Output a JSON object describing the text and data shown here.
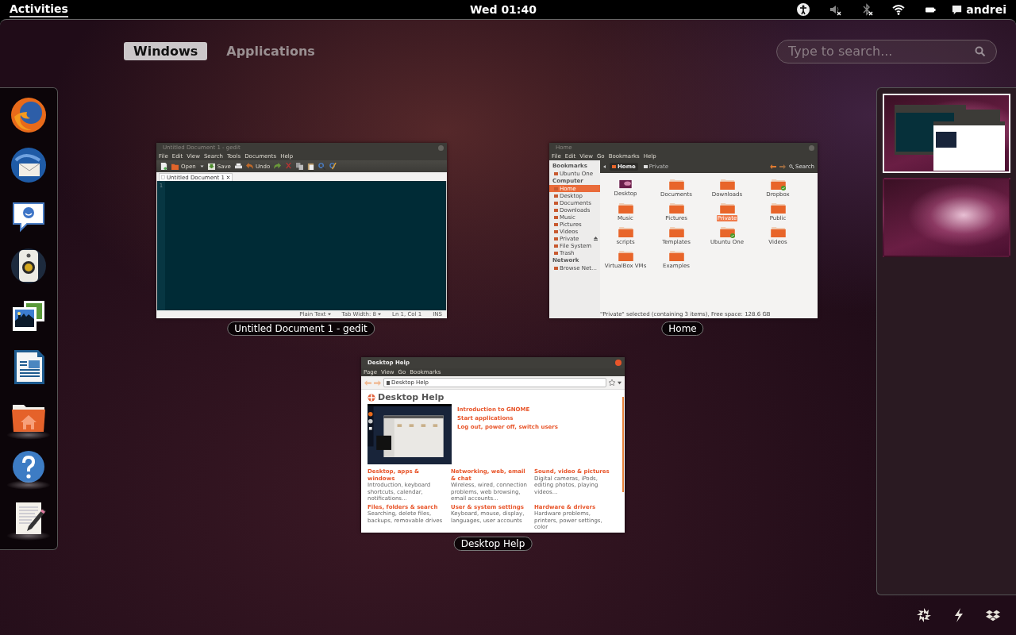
{
  "top_bar": {
    "activities": "Activities",
    "clock": "Wed 01:40",
    "user": "andrei"
  },
  "view_tabs": [
    {
      "label": "Windows",
      "selected": true
    },
    {
      "label": "Applications",
      "selected": false
    }
  ],
  "search": {
    "placeholder": "Type to search..."
  },
  "dash": [
    {
      "kind": "browser",
      "running": false
    },
    {
      "kind": "mail",
      "running": false
    },
    {
      "kind": "chat",
      "running": false
    },
    {
      "kind": "music",
      "running": false
    },
    {
      "kind": "photos",
      "running": false
    },
    {
      "kind": "writer",
      "running": false
    },
    {
      "kind": "files",
      "running": true
    },
    {
      "kind": "help",
      "running": true
    },
    {
      "kind": "editor",
      "running": true
    }
  ],
  "editor_window": {
    "title": "Untitled Document 1 - gedit",
    "caption": "Untitled Document 1 - gedit",
    "menu": [
      "File",
      "Edit",
      "View",
      "Search",
      "Tools",
      "Documents",
      "Help"
    ],
    "toolbar": [
      {
        "kind": "new"
      },
      {
        "kind": "open",
        "label": "Open"
      },
      {
        "kind": "dropdown"
      },
      {
        "kind": "save",
        "label": "Save"
      },
      {
        "kind": "print"
      },
      {
        "kind": "undo",
        "label": "Undo"
      },
      {
        "kind": "redo"
      },
      {
        "kind": "cut"
      },
      {
        "kind": "copy"
      },
      {
        "kind": "paste"
      },
      {
        "kind": "find"
      },
      {
        "kind": "replace"
      }
    ],
    "tab": "Untitled Document 1",
    "line_number": "1",
    "status": [
      {
        "text": "Plain Text",
        "dropdown": true
      },
      {
        "text": "Tab Width: 8",
        "dropdown": true
      },
      {
        "text": "Ln 1, Col 1",
        "dropdown": false
      },
      {
        "text": "INS",
        "dropdown": false
      }
    ]
  },
  "files_window": {
    "title": "Home",
    "caption": "Home",
    "menu": [
      "File",
      "Edit",
      "View",
      "Go",
      "Bookmarks",
      "Help"
    ],
    "sidebar": [
      {
        "heading": "Bookmarks",
        "items": [
          {
            "label": "Ubuntu One",
            "selected": false,
            "ejectable": false
          }
        ]
      },
      {
        "heading": "Computer",
        "items": [
          {
            "label": "Home",
            "selected": true,
            "ejectable": false
          },
          {
            "label": "Desktop",
            "selected": false,
            "ejectable": false
          },
          {
            "label": "Documents",
            "selected": false,
            "ejectable": false
          },
          {
            "label": "Downloads",
            "selected": false,
            "ejectable": false
          },
          {
            "label": "Music",
            "selected": false,
            "ejectable": false
          },
          {
            "label": "Pictures",
            "selected": false,
            "ejectable": false
          },
          {
            "label": "Videos",
            "selected": false,
            "ejectable": false
          },
          {
            "label": "Private",
            "selected": false,
            "ejectable": true
          },
          {
            "label": "File System",
            "selected": false,
            "ejectable": false
          },
          {
            "label": "Trash",
            "selected": false,
            "ejectable": false
          }
        ]
      },
      {
        "heading": "Network",
        "items": [
          {
            "label": "Browse Net…",
            "selected": false,
            "ejectable": false
          }
        ]
      }
    ],
    "path": [
      {
        "label": "Home",
        "selected": true
      },
      {
        "label": "Private",
        "selected": false
      }
    ],
    "search_label": "Search",
    "items": [
      {
        "name": "Desktop",
        "selected": false,
        "synced": false
      },
      {
        "name": "Documents",
        "kind": "folder",
        "selected": false,
        "synced": false
      },
      {
        "name": "Downloads",
        "kind": "folder",
        "selected": false,
        "synced": false
      },
      {
        "name": "Dropbox",
        "kind": "folder",
        "selected": false,
        "synced": true
      },
      {
        "name": "Music",
        "kind": "folder",
        "selected": false,
        "synced": false
      },
      {
        "name": "Pictures",
        "kind": "folder",
        "selected": false,
        "synced": false
      },
      {
        "name": "Private",
        "kind": "folder",
        "selected": true,
        "synced": false
      },
      {
        "name": "Public",
        "kind": "folder",
        "selected": false,
        "synced": false
      },
      {
        "name": "scripts",
        "kind": "folder",
        "selected": false,
        "synced": false
      },
      {
        "name": "Templates",
        "kind": "folder",
        "selected": false,
        "synced": false
      },
      {
        "name": "Ubuntu One",
        "kind": "folder",
        "selected": false,
        "synced": true
      },
      {
        "name": "Videos",
        "kind": "folder",
        "selected": false,
        "synced": false
      },
      {
        "name": "VirtualBox VMs",
        "kind": "folder",
        "selected": false,
        "synced": false
      },
      {
        "name": "Examples",
        "kind": "folder",
        "selected": false,
        "synced": false
      }
    ],
    "status": "\"Private\" selected (containing 3 items), Free space: 128.6 GB"
  },
  "help_window": {
    "title": "Desktop Help",
    "caption": "Desktop Help",
    "menu": [
      "Page",
      "View",
      "Go",
      "Bookmarks"
    ],
    "address": "Desktop Help",
    "heading": "Desktop Help",
    "links": [
      "Introduction to GNOME",
      "Start applications",
      "Log out, power off, switch users"
    ],
    "topics": [
      {
        "title": "Desktop, apps & windows",
        "text": "Introduction, keyboard shortcuts, calendar, notifications..."
      },
      {
        "title": "Networking, web, email & chat",
        "text": "Wireless, wired, connection problems, web browsing, email accounts..."
      },
      {
        "title": "Sound, video & pictures",
        "text": "Digital cameras, iPods, editing photos, playing videos..."
      },
      {
        "title": "Files, folders & search",
        "text": "Searching, delete files, backups, removable drives"
      },
      {
        "title": "User & system settings",
        "text": "Keyboard, mouse, display, languages, user accounts"
      },
      {
        "title": "Hardware & drivers",
        "text": "Hardware problems, printers, power settings, color"
      }
    ]
  },
  "workspaces": [
    {
      "selected": true,
      "has_windows": true
    },
    {
      "selected": false,
      "has_windows": false
    }
  ]
}
